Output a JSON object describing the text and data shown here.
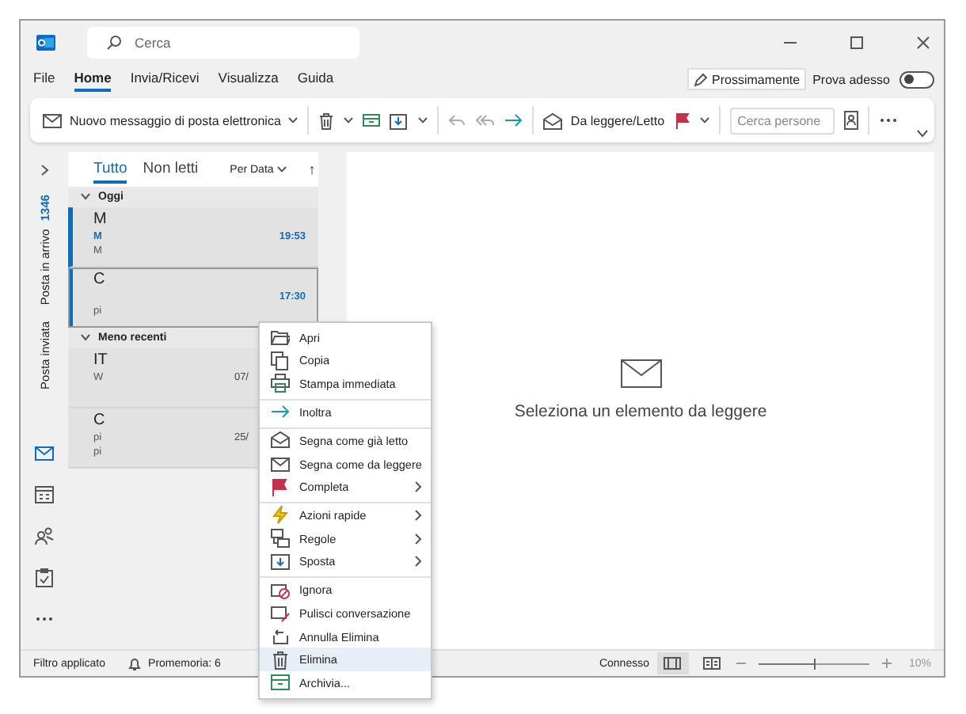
{
  "title_bar": {
    "search": {
      "placeholder": "Cerca"
    }
  },
  "menu_tabs": [
    {
      "label": "File",
      "selected": false
    },
    {
      "label": "Home",
      "selected": true
    },
    {
      "label": "Invia/Ricevi",
      "selected": false
    },
    {
      "label": "Visualizza",
      "selected": false
    },
    {
      "label": "Guida",
      "selected": false
    }
  ],
  "coming_soon": {
    "label": "Prossimamente"
  },
  "try_now": {
    "label": "Prova adesso",
    "on": false
  },
  "ribbon": {
    "new_message": "Nuovo messaggio di posta elettronica",
    "read_unread": "Da leggere/Letto",
    "people_search": {
      "placeholder": "Cerca persone"
    }
  },
  "folders": [
    {
      "label": "Posta in arrivo",
      "count": "1346"
    },
    {
      "label": "Posta inviata"
    }
  ],
  "apps": [
    {
      "selected": true
    },
    {
      "selected": false
    },
    {
      "selected": false
    },
    {
      "selected": false
    }
  ],
  "message_list": {
    "tabs": [
      {
        "label": "Tutto",
        "selected": true
      },
      {
        "label": "Non letti",
        "selected": false
      }
    ],
    "sort": "Per Data",
    "sort_direction": "↑",
    "groups": [
      {
        "label": "Oggi",
        "expanded": true,
        "messages": [
          {
            "sender": "M",
            "subject": "M",
            "preview": "M",
            "time": "19:53",
            "unread": true,
            "selected": false
          },
          {
            "sender": "C",
            "preview": "pi",
            "time": "17:30",
            "unread": true,
            "selected": true
          }
        ]
      },
      {
        "label": "Meno recenti",
        "expanded": true,
        "messages": [
          {
            "sender": "IT",
            "subject": "W",
            "time": "07/",
            "unread": false,
            "selected": false
          },
          {
            "sender": "C",
            "subject": "pi",
            "preview": "pi",
            "time": "25/",
            "unread": false,
            "selected": false
          }
        ]
      }
    ]
  },
  "reading_pane": {
    "message": "Seleziona un elemento da leggere"
  },
  "context_menu": [
    {
      "label": "Apri",
      "submenu": false,
      "divider_before": false,
      "selected": false
    },
    {
      "label": "Copia",
      "submenu": false,
      "divider_before": false,
      "selected": false
    },
    {
      "label": "Stampa immediata",
      "submenu": false,
      "divider_before": false,
      "selected": false
    },
    {
      "label": "Inoltra",
      "submenu": false,
      "divider_before": true,
      "selected": false
    },
    {
      "label": "Segna come già letto",
      "submenu": false,
      "divider_before": true,
      "selected": false
    },
    {
      "label": "Segna come da leggere",
      "submenu": false,
      "divider_before": false,
      "selected": false
    },
    {
      "label": "Completa",
      "submenu": true,
      "divider_before": false,
      "selected": false
    },
    {
      "label": "Azioni rapide",
      "submenu": true,
      "divider_before": true,
      "selected": false
    },
    {
      "label": "Regole",
      "submenu": true,
      "divider_before": false,
      "selected": false
    },
    {
      "label": "Sposta",
      "submenu": true,
      "divider_before": false,
      "selected": false
    },
    {
      "label": "Ignora",
      "submenu": false,
      "divider_before": true,
      "selected": false
    },
    {
      "label": "Pulisci conversazione",
      "submenu": false,
      "divider_before": false,
      "selected": false
    },
    {
      "label": "Annulla Elimina",
      "submenu": false,
      "divider_before": false,
      "selected": false
    },
    {
      "label": "Elimina",
      "submenu": false,
      "divider_before": false,
      "selected": true
    },
    {
      "label": "Archivia...",
      "submenu": false,
      "divider_before": false,
      "selected": false
    }
  ],
  "status_bar": {
    "filter": "Filtro applicato",
    "reminders": "Promemoria: 6",
    "connection": "Connesso",
    "views": [
      {
        "selected": true
      },
      {
        "selected": false
      }
    ],
    "zoom": {
      "level": 0.5,
      "reading": "10%"
    }
  }
}
